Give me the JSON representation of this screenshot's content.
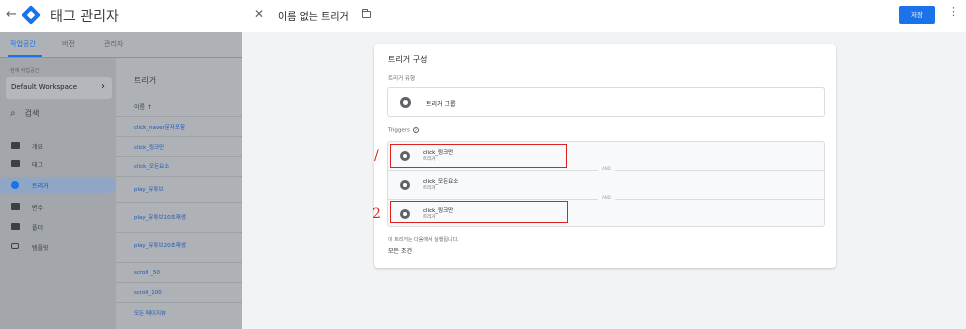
{
  "app": {
    "title": "태그 관리자",
    "tabs": [
      "작업공간",
      "버전",
      "관리자"
    ]
  },
  "workspace": {
    "label": "현재 작업공간",
    "name": "Default Workspace"
  },
  "search": {
    "label": "검색"
  },
  "nav": [
    {
      "label": "개요"
    },
    {
      "label": "태그"
    },
    {
      "label": "트리거"
    },
    {
      "label": "변수"
    },
    {
      "label": "폴더"
    },
    {
      "label": "템플릿"
    }
  ],
  "trigger_list": {
    "title": "트리거",
    "header": "이름 ↑",
    "items": [
      "click_naver문자포함",
      "click_링크만",
      "click_모든요소",
      "play_유튜브",
      "play_유튜브10초재생",
      "play_유튜브20초재생",
      "scroll _50",
      "scroll_100",
      "모든 페이지뷰"
    ]
  },
  "panel": {
    "title": "이름 없는 트리거",
    "save_label": "저장",
    "card_title": "트리거 구성",
    "trigger_type_label": "트리거 유형",
    "trigger_type_value": "트리거 그룹",
    "triggers_label": "Triggers",
    "and_label": "AND",
    "triggers": [
      {
        "name": "click_링크만",
        "type": "트리거"
      },
      {
        "name": "click_모든요소",
        "type": "트리거"
      },
      {
        "name": "click_링크만",
        "type": "트리거"
      }
    ],
    "fires_on_label": "이 트리거는 다음에서 실행됩니다.",
    "fires_on_value": "모든 조건"
  },
  "annotations": {
    "mark1": "/",
    "mark2": "2"
  },
  "colors": {
    "accent": "#1a73e8",
    "annotation": "#e02020"
  }
}
